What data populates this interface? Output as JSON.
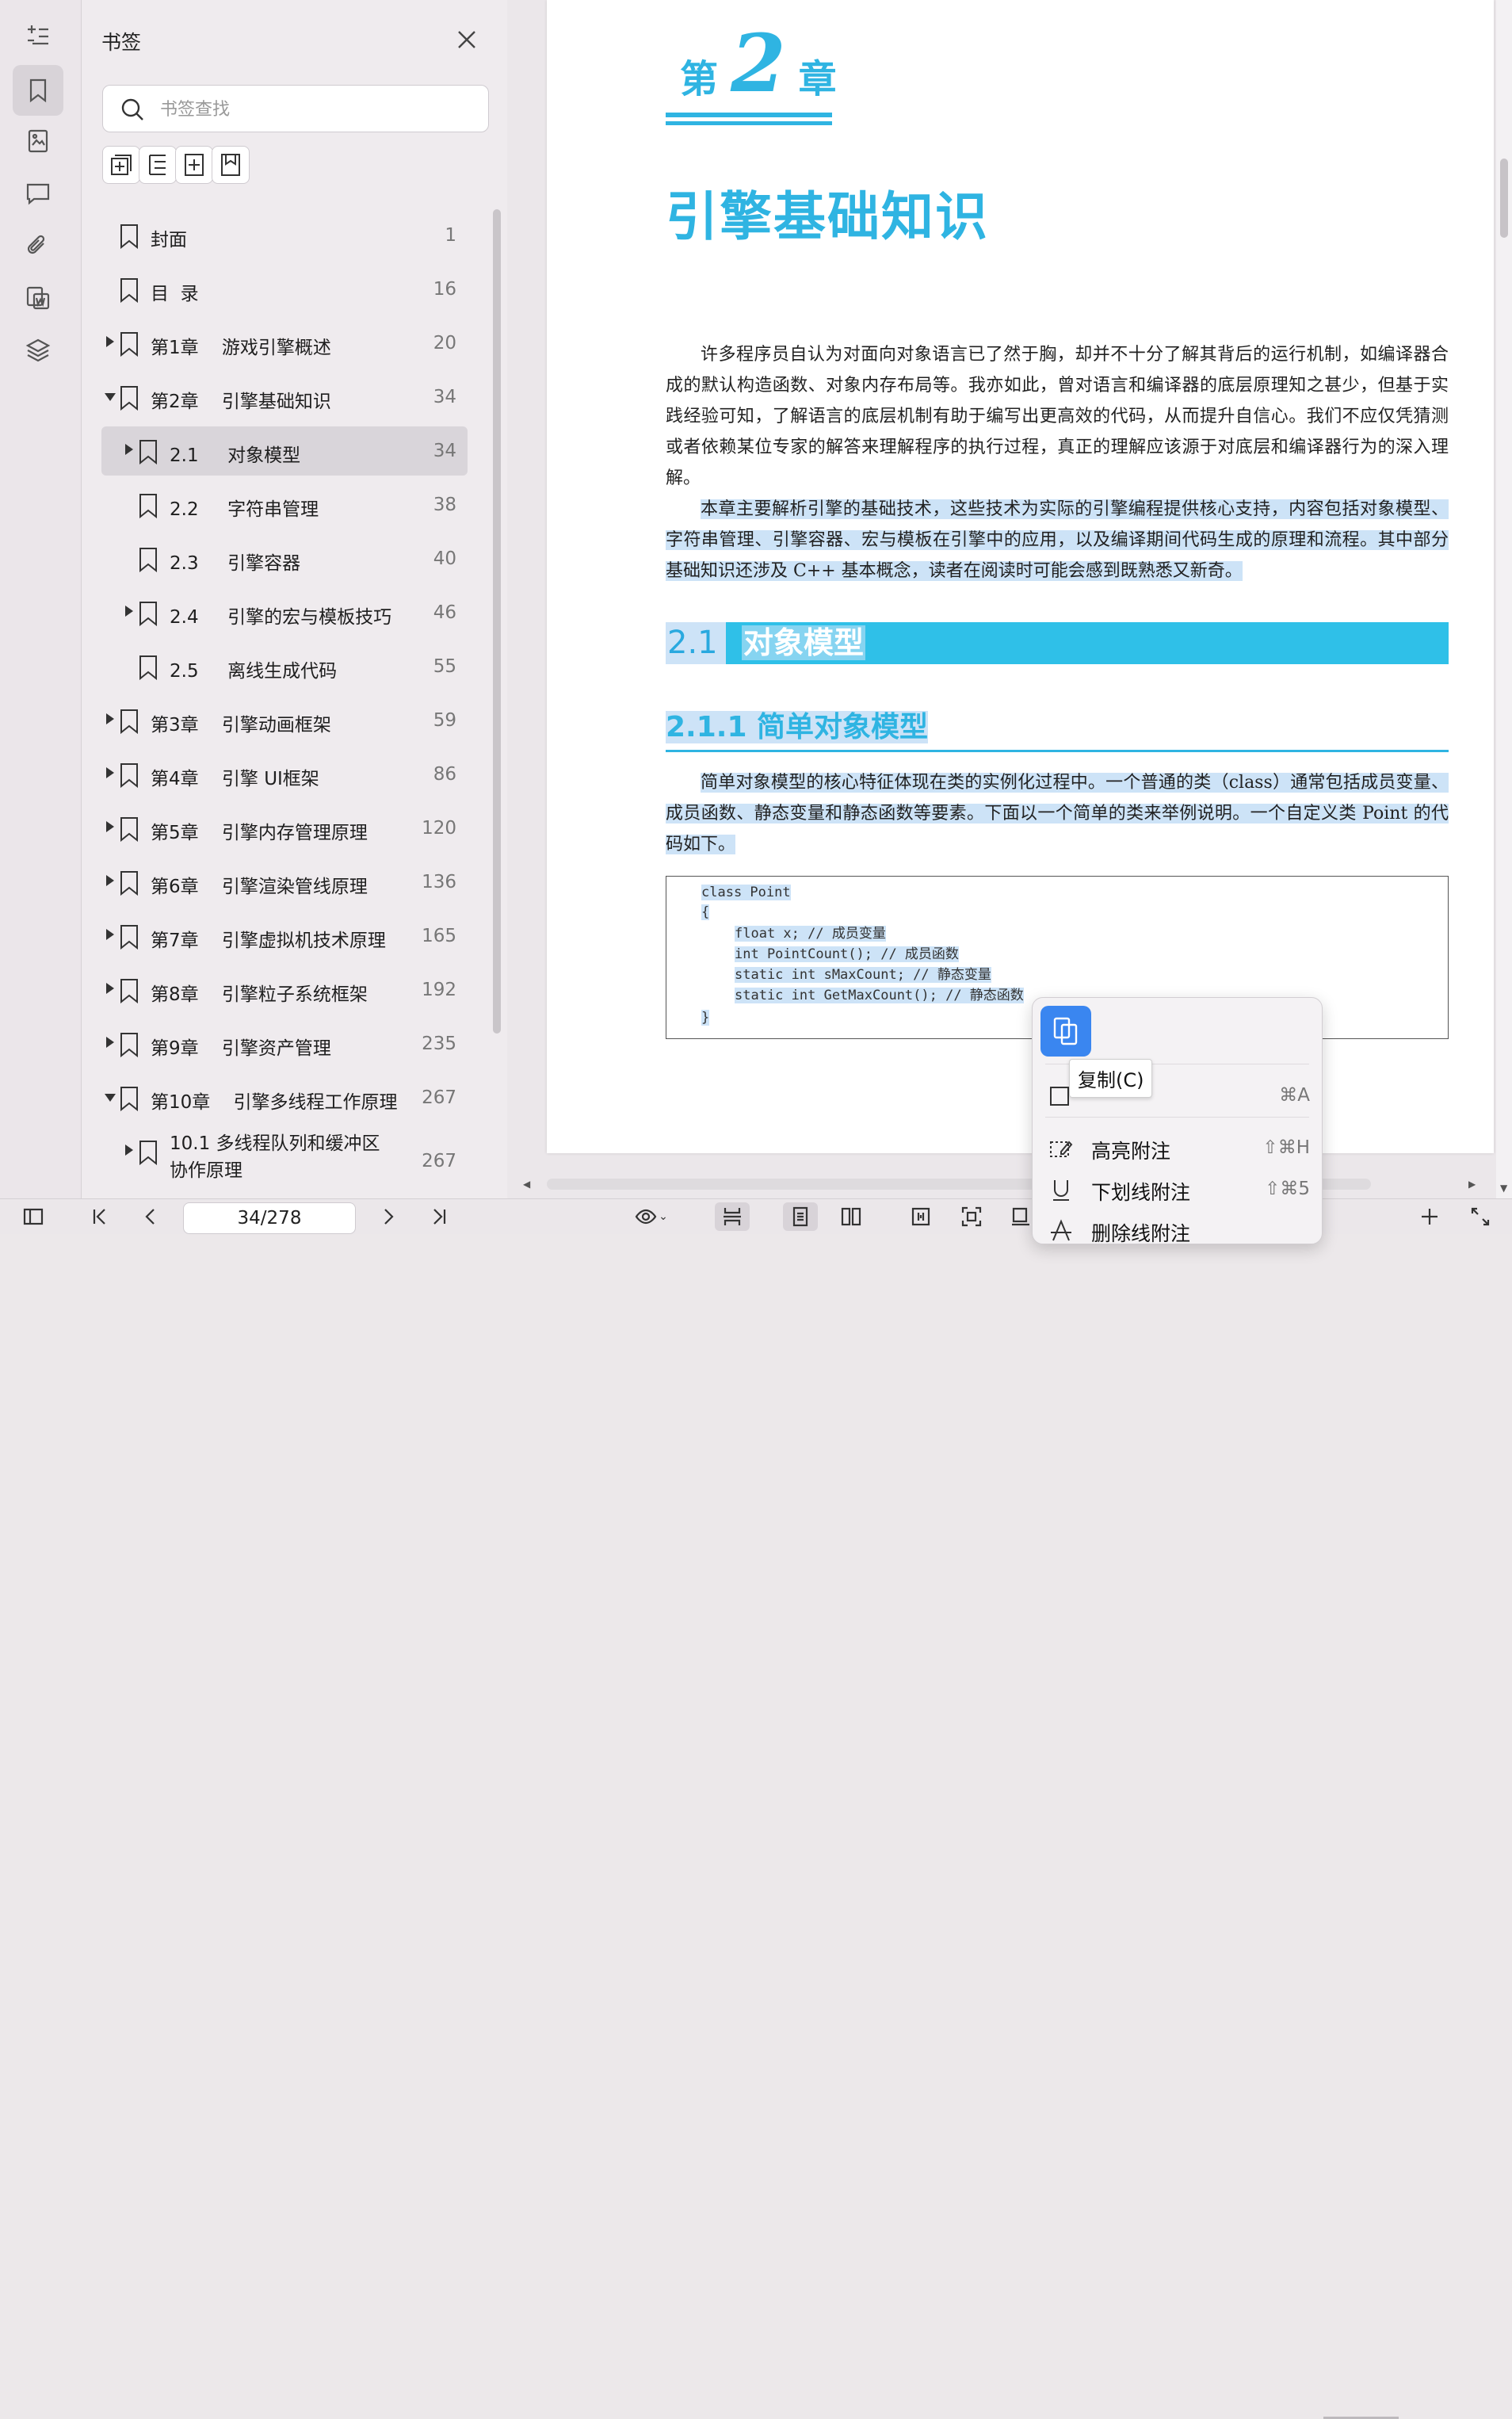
{
  "panel": {
    "title": "书签",
    "search_placeholder": "书签查找"
  },
  "bookmarks": [
    {
      "label": "封面",
      "page": "1",
      "level": 0,
      "expander": "none"
    },
    {
      "label": "目  录",
      "page": "16",
      "level": 0,
      "expander": "none"
    },
    {
      "label": "第1章    游戏引擎概述",
      "page": "20",
      "level": 0,
      "expander": "right"
    },
    {
      "label": "第2章    引擎基础知识",
      "page": "34",
      "level": 0,
      "expander": "down"
    },
    {
      "label": "2.1     对象模型",
      "page": "34",
      "level": 1,
      "expander": "right",
      "selected": true
    },
    {
      "label": "2.2     字符串管理",
      "page": "38",
      "level": 1,
      "expander": "none"
    },
    {
      "label": "2.3     引擎容器",
      "page": "40",
      "level": 1,
      "expander": "none"
    },
    {
      "label": "2.4     引擎的宏与模板技巧",
      "page": "46",
      "level": 1,
      "expander": "right"
    },
    {
      "label": "2.5     离线生成代码",
      "page": "55",
      "level": 1,
      "expander": "none"
    },
    {
      "label": "第3章    引擎动画框架",
      "page": "59",
      "level": 0,
      "expander": "right"
    },
    {
      "label": "第4章    引擎 UI框架",
      "page": "86",
      "level": 0,
      "expander": "right"
    },
    {
      "label": "第5章    引擎内存管理原理",
      "page": "120",
      "level": 0,
      "expander": "right"
    },
    {
      "label": "第6章    引擎渲染管线原理",
      "page": "136",
      "level": 0,
      "expander": "right"
    },
    {
      "label": "第7章    引擎虚拟机技术原理",
      "page": "165",
      "level": 0,
      "expander": "right"
    },
    {
      "label": "第8章    引擎粒子系统框架",
      "page": "192",
      "level": 0,
      "expander": "right"
    },
    {
      "label": "第9章    引擎资产管理",
      "page": "235",
      "level": 0,
      "expander": "right"
    },
    {
      "label": "第10章    引擎多线程工作原理",
      "page": "267",
      "level": 0,
      "expander": "down"
    },
    {
      "label": "10.1     多线程队列和缓冲区\n协作原理",
      "page": "267",
      "level": 1,
      "expander": "right"
    }
  ],
  "document": {
    "chapter_word_left": "第",
    "chapter_number": "2",
    "chapter_word_right": "章",
    "chapter_title": "引擎基础知识",
    "para1": "许多程序员自认为对面向对象语言已了然于胸，却并不十分了解其背后的运行机制，如编译器合成的默认构造函数、对象内存布局等。我亦如此，曾对语言和编译器的底层原理知之甚少，但基于实践经验可知，了解语言的底层机制有助于编写出更高效的代码，从而提升自信心。我们不应仅凭猜测或者依赖某位专家的解答来理解程序的执行过程，真正的理解应该源于对底层和编译器行为的深入理解。",
    "para2": "本章主要解析引擎的基础技术，这些技术为实际的引擎编程提供核心支持，内容包括对象模型、字符串管理、引擎容器、宏与模板在引擎中的应用，以及编译期间代码生成的原理和流程。其中部分基础知识还涉及 C++ 基本概念，读者在阅读时可能会感到既熟悉又新奇。",
    "section_number": "2.1",
    "section_title": "对象模型",
    "subsection": "2.1.1   简单对象模型",
    "para3": "简单对象模型的核心特征体现在类的实例化过程中。一个普通的类（class）通常包括成员变量、成员函数、静态变量和静态函数等要素。下面以一个简单的类来举例说明。一个自定义类 Point 的代码如下。",
    "code": {
      "line1": "class Point",
      "line2": "{",
      "line3": "float x; // 成员变量",
      "line4": "int PointCount(); // 成员函数",
      "line5": "static int sMaxCount; // 静态变量",
      "line6": "static int GetMaxCount(); // 静态函数",
      "line7": "}"
    }
  },
  "context_menu": {
    "tooltip": "复制(C)",
    "select_all_shortcut": "⌘A",
    "items": [
      {
        "label": "高亮附注",
        "shortcut": "⇧⌘H"
      },
      {
        "label": "下划线附注",
        "shortcut": "⇧⌘5"
      },
      {
        "label": "删除线附注",
        "shortcut": ""
      }
    ]
  },
  "toolbar": {
    "page_indicator": "34/278"
  },
  "colors": {
    "accent": "#2fb4e2",
    "selection": "#cde3f7",
    "copy_button": "#3a86f0"
  }
}
